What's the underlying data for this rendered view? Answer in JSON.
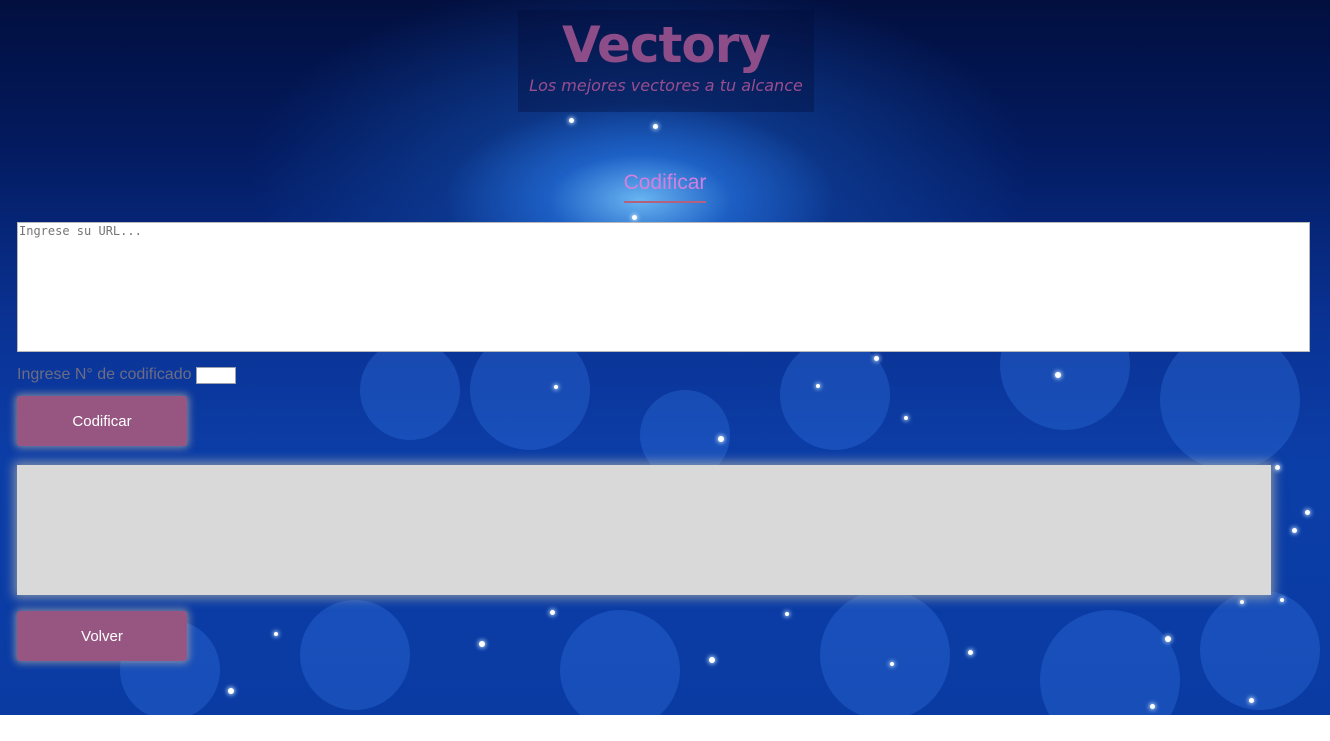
{
  "header": {
    "logo_text": "Vectory",
    "tagline": "Los mejores vectores a tu alcance"
  },
  "form": {
    "section_title": "Codificar",
    "url_placeholder": "Ingrese su URL...",
    "url_value": "",
    "code_label": "Ingrese N° de codificado",
    "code_value": "",
    "encode_button_label": "Codificar",
    "output_value": "",
    "back_button_label": "Volver"
  },
  "colors": {
    "brand_purple": "#975682",
    "title_pink": "#d27fe0",
    "output_background": "#d9d9d9",
    "background_blue": "#0a3294"
  }
}
